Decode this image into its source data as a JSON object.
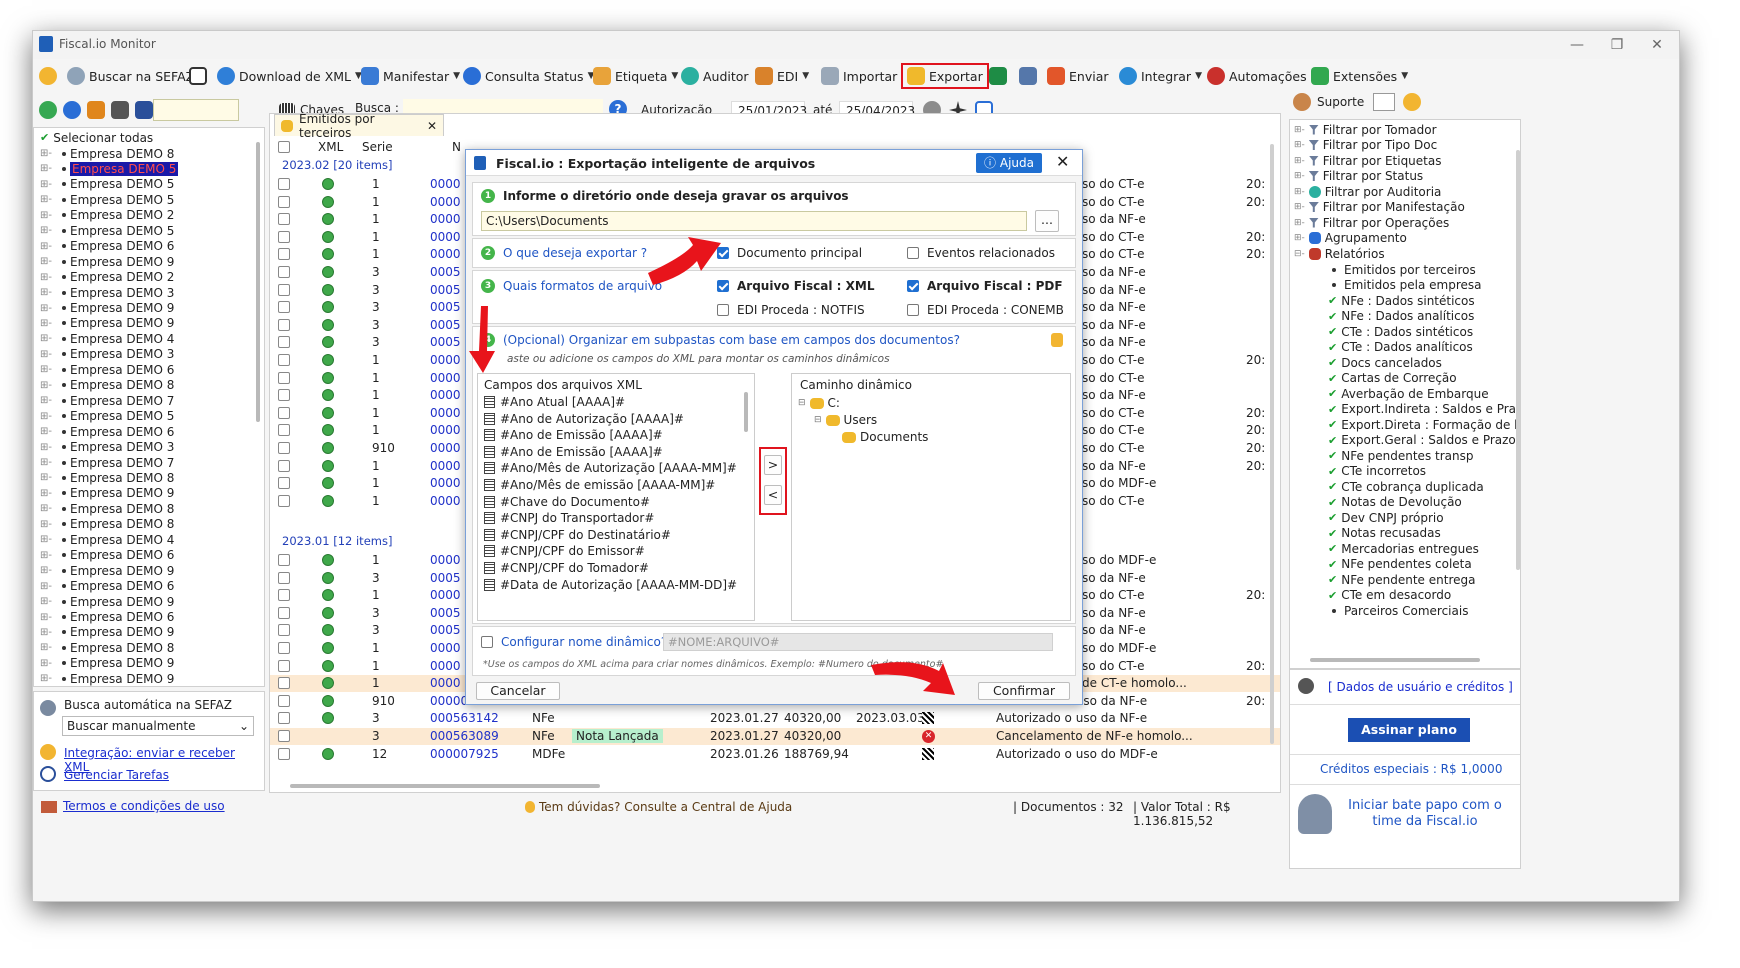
{
  "window": {
    "title": "Fiscal.io Monitor"
  },
  "toolbar": {
    "buscar_sefaz": "Buscar na SEFAZ",
    "download_xml": "Download de XML",
    "manifestar": "Manifestar",
    "consulta_status": "Consulta Status",
    "etiqueta": "Etiqueta",
    "auditor": "Auditor",
    "edi": "EDI",
    "importar": "Importar",
    "exportar": "Exportar",
    "enviar": "Enviar",
    "integrar": "Integrar",
    "automacoes": "Automações",
    "extensoes": "Extensões",
    "suporte": "Suporte"
  },
  "subbar": {
    "chaves": "Chaves",
    "busca_label": "Busca :",
    "autorizacao": "Autorização",
    "date_from": "25/01/2023",
    "ate": "até",
    "date_to": "25/04/2023"
  },
  "left_tree": {
    "select_all": "Selecionar todas",
    "items": [
      "Empresa DEMO 8",
      "Empresa DEMO 5",
      "Empresa DEMO 5",
      "Empresa DEMO 5",
      "Empresa DEMO 2",
      "Empresa DEMO 5",
      "Empresa DEMO 6",
      "Empresa DEMO 9",
      "Empresa DEMO 2",
      "Empresa DEMO 3",
      "Empresa DEMO 9",
      "Empresa DEMO 9",
      "Empresa DEMO 4",
      "Empresa DEMO 3",
      "Empresa DEMO 6",
      "Empresa DEMO 8",
      "Empresa DEMO 7",
      "Empresa DEMO 5",
      "Empresa DEMO 6",
      "Empresa DEMO 3",
      "Empresa DEMO 7",
      "Empresa DEMO 8",
      "Empresa DEMO 9",
      "Empresa DEMO 8",
      "Empresa DEMO 8",
      "Empresa DEMO 4",
      "Empresa DEMO 6",
      "Empresa DEMO 9",
      "Empresa DEMO 6",
      "Empresa DEMO 9",
      "Empresa DEMO 6",
      "Empresa DEMO 9",
      "Empresa DEMO 8",
      "Empresa DEMO 9",
      "Empresa DEMO 9",
      "Empresa DEMO 5"
    ],
    "selected_index": 1
  },
  "left_bottom": {
    "auto_search": "Busca automática na SEFAZ",
    "mode": "Buscar manualmente",
    "integracao": "Integração: enviar e receber XML",
    "tarefas": "Gerenciar Tarefas",
    "termos": "Termos e condições de uso"
  },
  "grid": {
    "tab": "Emitidos por terceiros",
    "headers": {
      "xml": "XML",
      "serie": "Serie",
      "n": "N"
    },
    "group1": "2023.02 [20 items]",
    "group2": "2023.01 [12 items]",
    "g1_series": [
      "1",
      "1",
      "1",
      "1",
      "1",
      "3",
      "3",
      "3",
      "3",
      "3",
      "1",
      "1",
      "1",
      "1",
      "1",
      "910",
      "1",
      "1",
      "1"
    ],
    "g1_nums": [
      "0000",
      "0000",
      "0000",
      "0000",
      "0000",
      "0005",
      "0005",
      "0005",
      "0005",
      "0005",
      "0000",
      "0000",
      "0000",
      "0000",
      "0000",
      "0000",
      "0000",
      "0000",
      "0000"
    ],
    "g1_right": [
      "so do CT-e",
      "so do CT-e",
      "so da NF-e",
      "so do CT-e",
      "so do CT-e",
      "so da NF-e",
      "so da NF-e",
      "so da NF-e",
      "so da NF-e",
      "so da NF-e",
      "so do CT-e",
      "so do CT-e",
      "so da NF-e",
      "so do CT-e",
      "so do CT-e",
      "so do CT-e",
      "so da NF-e",
      "so do MDF-e",
      "so do CT-e",
      "so do CT-e"
    ],
    "g1_year": [
      "20:",
      "20:",
      "",
      "20:",
      "20:",
      "",
      "",
      "",
      "",
      "",
      "20:",
      "",
      "",
      "20:",
      "20:",
      "20:",
      "20:",
      "",
      "",
      ""
    ],
    "g2_series": [
      "1",
      "3",
      "1",
      "3",
      "3",
      "1",
      "1",
      "1",
      "910",
      "3",
      "3",
      "12"
    ],
    "g2_nums": [
      "0000",
      "0005",
      "0000",
      "0005",
      "0005",
      "0000",
      "0000",
      "0000",
      "000000005",
      "000563142",
      "000563089",
      "000007925"
    ],
    "g2_right": [
      "so do MDF-e",
      "so da NF-e",
      "so do CT-e",
      "so da NF-e",
      "so da NF-e",
      "so do MDF-e",
      "so do CT-e",
      "de CT-e homolo...",
      "Autorizado o uso da NF-e",
      "Autorizado o uso da NF-e",
      "Cancelamento de NF-e homolo...",
      "Autorizado o uso do MDF-e"
    ],
    "g2_year": [
      "",
      "",
      "20:",
      "",
      "",
      "",
      "20:",
      "",
      "20:",
      "",
      "",
      ""
    ],
    "tail_rows": [
      {
        "tipo": "NFe",
        "nota": "",
        "data": "2023.01.27",
        "valor": "40320,00",
        "extra": "2023.03.03"
      },
      {
        "tipo": "NFe",
        "nota": "Nota Lançada",
        "data": "2023.01.27",
        "valor": "40320,00",
        "extra": ""
      },
      {
        "tipo": "MDFe",
        "nota": "",
        "data": "2023.01.26",
        "valor": "188769,94",
        "extra": ""
      }
    ]
  },
  "status_bar": {
    "help": "Tem dúvidas? Consulte a Central de Ajuda",
    "documentos": "Documentos : 32",
    "valor_total": "Valor Total : R$ 1.136.815,52"
  },
  "right_panel": {
    "filters": [
      "Filtrar por Tomador",
      "Filtrar por Tipo Doc",
      "Filtrar por Etiquetas",
      "Filtrar por Status",
      "Filtrar por Auditoria",
      "Filtrar por Manifestação",
      "Filtrar por Operações",
      "Agrupamento",
      "Relatórios"
    ],
    "reports": [
      "Emitidos por terceiros",
      "Emitidos pela empresa",
      "NFe : Dados sintéticos",
      "NFe : Dados analíticos",
      "CTe : Dados sintéticos",
      "CTe : Dados analíticos",
      "Docs cancelados",
      "Cartas de Correção",
      "Averbação de Embarque",
      "Export.Indireta : Saldos e Pra",
      "Export.Direta : Formação de l",
      "Export.Geral : Saldos e Prazo",
      "NFe pendentes transp",
      "CTe incorretos",
      "CTe cobrança duplicada",
      "Notas de Devolução",
      "Dev CNPJ próprio",
      "Notas recusadas",
      "Mercadorias entregues",
      "NFe pendentes coleta",
      "NFe pendente entrega",
      "CTe em desacordo",
      "Parceiros Comerciais"
    ],
    "dados_usuario": "[ Dados de usuário e créditos ]",
    "assinar": "Assinar plano",
    "creditos": "Créditos especiais : R$ 1,0000",
    "chat": "Iniciar bate papo com o time da Fiscal.io"
  },
  "dialog": {
    "title": "Fiscal.io : Exportação inteligente de arquivos",
    "ajuda": "Ajuda",
    "step1": "Informe o diretório onde deseja gravar os arquivos",
    "path": "C:\\Users\\Documents",
    "browse": "...",
    "step2": "O que deseja exportar ?",
    "doc_principal": "Documento principal",
    "eventos": "Eventos relacionados",
    "step3": "Quais formatos de arquivo",
    "xml": "Arquivo Fiscal : XML",
    "pdf": "Arquivo Fiscal : PDF",
    "notfis": "EDI Proceda : NOTFIS",
    "conemb": "EDI Proceda : CONEMB",
    "step4": "(Opcional) Organizar em subpastas com base em campos dos documentos?",
    "step4_hint": "aste ou adicione os campos do XML para montar os caminhos dinâmicos",
    "campos_title": "Campos dos arquivos XML",
    "campos": [
      "#Ano Atual [AAAA]#",
      "#Ano de Autorização [AAAA]#",
      "#Ano de Emissão [AAAA]#",
      "#Ano de Emissão [AAAA]#",
      "#Ano/Mês de Autorização [AAAA-MM]#",
      "#Ano/Mês de emissão [AAAA-MM]#",
      "#Chave do Documento#",
      "#CNPJ do Transportador#",
      "#CNPJ/CPF do Destinatário#",
      "#CNPJ/CPF do Emissor#",
      "#CNPJ/CPF do Tomador#",
      "#Data de Autorização [AAAA-MM-DD]#"
    ],
    "add_btn": ">",
    "remove_btn": "<",
    "caminho_title": "Caminho dinâmico",
    "tree": [
      "C:",
      "Users",
      "Documents"
    ],
    "nome_dinamico": "Configurar nome dinâmico?",
    "nome_placeholder": "#NOME:ARQUIVO#",
    "nome_hint": "*Use os campos do XML acima para criar nomes dinâmicos. Exemplo: #Numero do documento#",
    "cancelar": "Cancelar",
    "confirmar": "Confirmar"
  },
  "colors": {
    "accent": "#1f6fd1",
    "highlight": "#e0141e",
    "plan_button": "#1b4fb3"
  }
}
